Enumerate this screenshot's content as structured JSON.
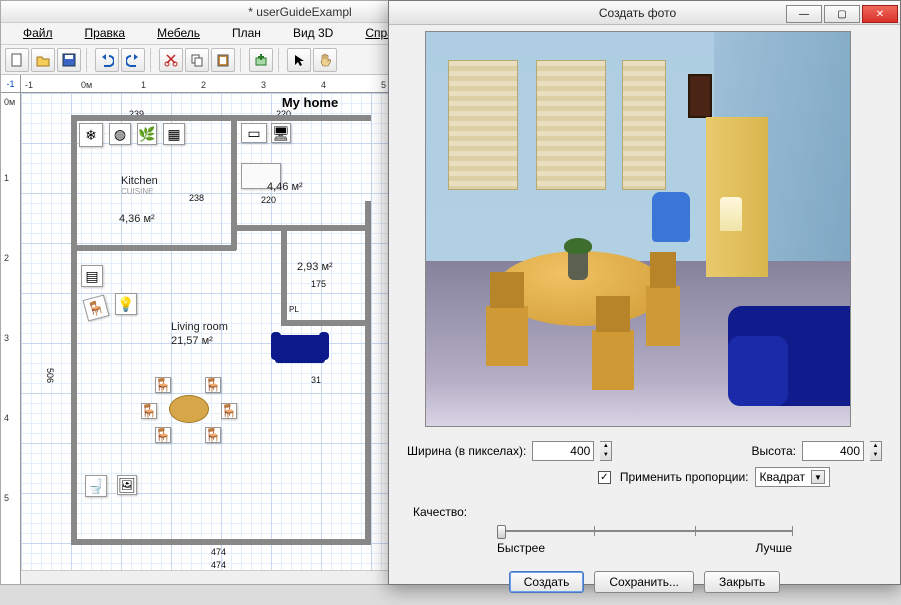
{
  "main_window": {
    "title": "* userGuideExampl",
    "menu": {
      "file": "Файл",
      "edit": "Правка",
      "furniture": "Мебель",
      "plan": "План",
      "view3d": "Вид 3D",
      "help": "Справка"
    },
    "toolbar_icons": [
      "new",
      "open",
      "save",
      "sep",
      "undo",
      "redo",
      "sep",
      "cut",
      "copy",
      "paste",
      "sep",
      "add-furn",
      "sep",
      "pointer",
      "hand"
    ],
    "ruler_corner": "-1",
    "ruler_h_units": "0м",
    "ruler_h_marks": [
      "-1",
      "0м",
      "1",
      "2",
      "3",
      "4",
      "5"
    ],
    "ruler_v_units": "0м",
    "ruler_v_marks": [
      "0м",
      "1",
      "2",
      "3",
      "4",
      "5"
    ],
    "plan_title": "My home",
    "dims": {
      "top_left": "239",
      "top_right": "220",
      "k_w": "238",
      "lr_w": "220",
      "k_area_lbl": "Kitchen",
      "k_area": "4,36 м²",
      "br_area": "4,46 м²",
      "bath_area": "2,93 м²",
      "bath_w": "175",
      "lr_lbl": "Living room",
      "lr_area": "21,57 м²",
      "lr_left": "506",
      "bottom": "474",
      "bottom2": "474",
      "pl": "PL",
      "side": "31",
      "cuisine": "CUISINE"
    }
  },
  "dialog": {
    "title": "Создать фото",
    "width_label": "Ширина (в пикселах):",
    "width_value": "400",
    "height_label": "Высота:",
    "height_value": "400",
    "ratio_label": "Применить пропорции:",
    "ratio_checked": true,
    "ratio_value": "Квадрат",
    "quality_label": "Качество:",
    "quality_fast": "Быстрее",
    "quality_best": "Лучше",
    "create_btn": "Создать",
    "save_btn": "Сохранить...",
    "close_btn": "Закрыть"
  }
}
